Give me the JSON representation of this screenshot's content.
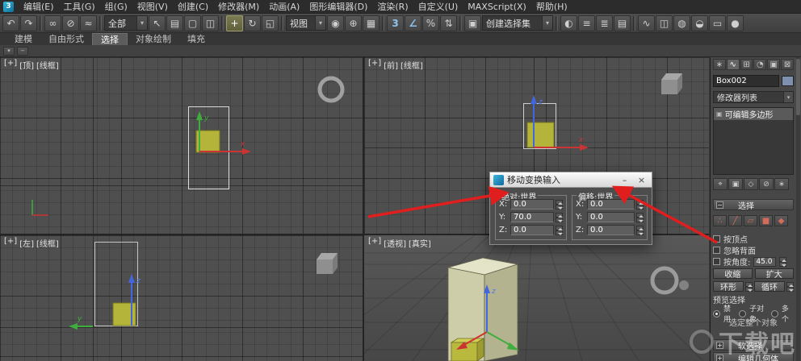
{
  "menubar": {
    "logo": "3",
    "items": [
      "编辑(E)",
      "工具(G)",
      "组(G)",
      "视图(V)",
      "创建(C)",
      "修改器(M)",
      "动画(A)",
      "图形编辑器(D)",
      "渲染(R)",
      "自定义(U)",
      "MAXScript(X)",
      "帮助(H)"
    ]
  },
  "toolbar": {
    "filter_value": "全部",
    "coord_value": "视图",
    "sets_value": "创建选择集"
  },
  "ribbon": {
    "tabs": [
      "建模",
      "自由形式",
      "选择",
      "对象绘制",
      "填充"
    ]
  },
  "viewports": {
    "top": {
      "plus": "[+]",
      "view": "[顶]",
      "shading": "[线框]"
    },
    "front": {
      "plus": "[+]",
      "view": "[前]",
      "shading": "[线框]"
    },
    "left": {
      "plus": "[+]",
      "view": "[左]",
      "shading": "[线框]"
    },
    "persp": {
      "plus": "[+]",
      "view": "[透视]",
      "shading": "[真实]"
    }
  },
  "axis": {
    "x": "x",
    "y": "y",
    "z": "z"
  },
  "dialog": {
    "title": "移动变换输入",
    "absolute_group": "绝对:世界",
    "offset_group": "偏移:世界",
    "x_label": "X:",
    "y_label": "Y:",
    "z_label": "Z:",
    "absolute": {
      "x": "0.0",
      "y": "70.0",
      "z": "0.0"
    },
    "offset": {
      "x": "0.0",
      "y": "0.0",
      "z": "0.0"
    }
  },
  "panel": {
    "object_name": "Box002",
    "modifier_list": "修改器列表",
    "stack_item": "可编辑多边形",
    "selection_title": "选择",
    "by_vertex": "按顶点",
    "ignore_backfacing": "忽略背面",
    "by_angle": "按角度:",
    "angle_value": "45.0",
    "shrink": "收缩",
    "grow": "扩大",
    "ring": "环形",
    "loop": "循环",
    "preview_label": "预览选择",
    "radio_disable": "禁用",
    "radio_subobject": "子对象",
    "radio_multiple": "多个",
    "status_text": "选定整个对象",
    "soft_selection": "软选择",
    "edit_geometry": "编辑几何体"
  },
  "watermark": "下载吧",
  "icons": {
    "undo": "↶",
    "redo": "↷",
    "link": "∞",
    "unlink": "⊘",
    "bind": "≈",
    "select": "↖",
    "byname": "▤",
    "region": "▢",
    "crossing": "◫",
    "move": "+",
    "rotate": "↻",
    "scale": "◱",
    "pivot": "◉",
    "manip": "⊕",
    "kbd": "▦",
    "snap": "3",
    "asnap": "∠",
    "psnap": "%",
    "ssnap": "⇅",
    "sets": "▣",
    "mirror": "◐",
    "align": "≡",
    "layers": "≣",
    "ribbon": "▤",
    "curve": "∿",
    "schem": "◫",
    "mat": "◍",
    "rsetup": "◒",
    "rframe": "▭",
    "render": "●",
    "dd": "▾",
    "min": "–",
    "close": "×",
    "plus": "+",
    "minus": "−",
    "cp_create": "∗",
    "cp_modify": "∿",
    "cp_hier": "⊞",
    "cp_motion": "◔",
    "cp_disp": "▣",
    "cp_util": "⊠",
    "sb_pin": "⌖",
    "sb_show": "▣",
    "sb_unique": "◇",
    "sb_remove": "⊘",
    "sb_cfg": "∗",
    "so_vertex": "∴",
    "so_edge": "╱",
    "so_border": "▱",
    "so_poly": "■",
    "so_elem": "◆"
  }
}
